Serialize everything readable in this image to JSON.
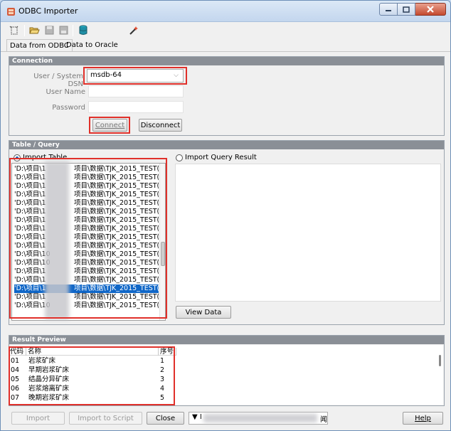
{
  "window": {
    "title": "ODBC Importer"
  },
  "toolbar": {
    "icons": [
      "new-icon",
      "open-folder-icon",
      "save-icon",
      "save-as-icon",
      "database-icon",
      "magic-wand-icon"
    ]
  },
  "tabs": [
    {
      "label": "Data from ODBC",
      "active": true
    },
    {
      "label": "Data to Oracle",
      "active": false
    }
  ],
  "connection": {
    "header": "Connection",
    "dsn_label": "User / System DSN",
    "dsn_value": "msdb-64",
    "username_label": "User Name",
    "username_value": "",
    "password_label": "Password",
    "password_value": "",
    "connect_label": "Connect",
    "disconnect_label": "Disconnect"
  },
  "table_query": {
    "header": "Table / Query",
    "import_table_label": "Import Table",
    "import_query_label": "Import Query Result",
    "view_data_label": "View Data",
    "items": [
      "'D:\\项目\\1",
      "'D:\\项目\\1",
      "'D:\\项目\\1",
      "'D:\\项目\\1",
      "'D:\\项目\\1",
      "'D:\\项目\\1",
      "'D:\\项目\\1",
      "'D:\\项目\\1",
      "'D:\\项目\\1",
      "'D:\\项目\\1",
      "'D:\\项目\\10",
      "'D:\\项目\\10",
      "'D:\\项目\\1",
      "'D:\\项目\\1",
      "'D:\\项目\\1",
      "'D:\\项目\\1",
      "'D:\\项目\\10"
    ],
    "items_suffix": "项目\\数据\\TJK_2015_TEST(2022",
    "selected_index": 14
  },
  "result_preview": {
    "header": "Result Preview",
    "columns": [
      "代码",
      "名称",
      "序号"
    ],
    "rows": [
      [
        "01",
        "岩浆矿床",
        "1"
      ],
      [
        "04",
        "早期岩浆矿床",
        "2"
      ],
      [
        "05",
        "结晶分异矿床",
        "3"
      ],
      [
        "06",
        "岩浆熔离矿床",
        "4"
      ],
      [
        "07",
        "晚期岩浆矿床",
        "5"
      ]
    ]
  },
  "bottom": {
    "import_label": "Import",
    "import_script_label": "Import to Script",
    "close_label": "Close",
    "help_label": "Help",
    "combo_text": "▼ I",
    "combo_tail": "闻"
  },
  "colors": {
    "highlight_red": "#e0302a",
    "selection_blue": "#0f66c7",
    "panel_header": "#8a8f96"
  }
}
